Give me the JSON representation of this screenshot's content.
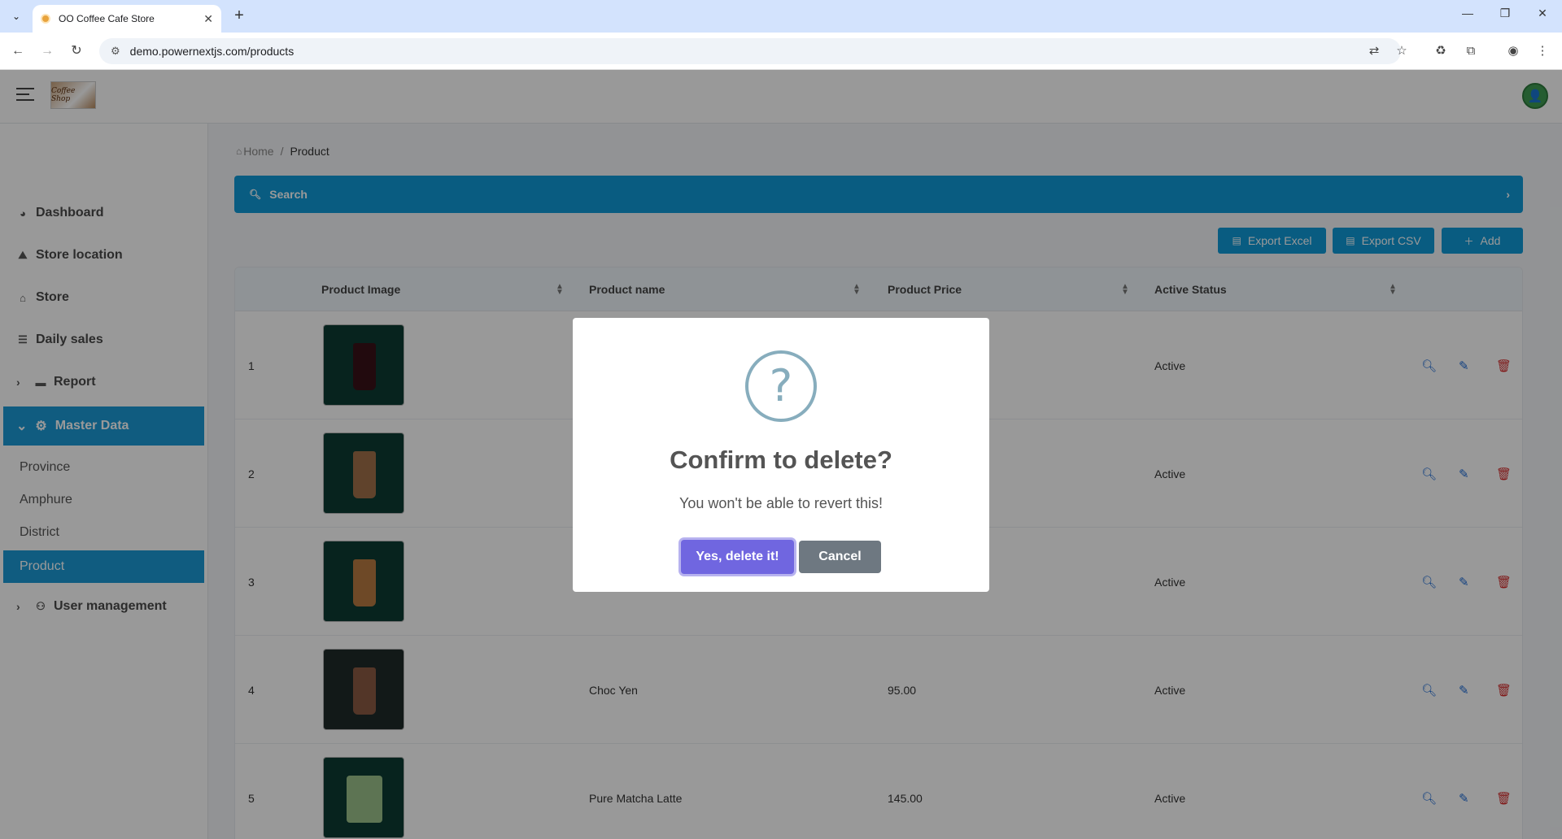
{
  "browser": {
    "tab_title": "OO Coffee Cafe Store",
    "url": "demo.powernextjs.com/products"
  },
  "header": {
    "logo_text": "Coffee Shop"
  },
  "sidebar": {
    "items": [
      {
        "label": "Dashboard",
        "icon": "dashboard-icon"
      },
      {
        "label": "Store location",
        "icon": "map-icon"
      },
      {
        "label": "Store",
        "icon": "store-icon"
      },
      {
        "label": "Daily sales",
        "icon": "list-icon"
      },
      {
        "label": "Report",
        "icon": "folder-icon"
      },
      {
        "label": "Master Data",
        "icon": "users-cog-icon"
      },
      {
        "label": "User management",
        "icon": "user-cog-icon"
      }
    ],
    "sub_items": [
      "Province",
      "Amphure",
      "District",
      "Product"
    ]
  },
  "breadcrumb": {
    "home": "Home",
    "current": "Product"
  },
  "search": {
    "label": "Search"
  },
  "toolbar": {
    "export_excel": "Export Excel",
    "export_csv": "Export CSV",
    "add": "Add"
  },
  "table": {
    "headers": [
      "Product Image",
      "Product name",
      "Product Price",
      "Active Status"
    ],
    "rows": [
      {
        "no": "1",
        "name": "",
        "price": "",
        "status": "Active",
        "cup_color": "#3a1218"
      },
      {
        "no": "2",
        "name": "",
        "price": "",
        "status": "Active",
        "cup_color": "#a0704a"
      },
      {
        "no": "3",
        "name": "",
        "price": "",
        "status": "Active",
        "cup_color": "#b87a42"
      },
      {
        "no": "4",
        "name": "Choc Yen",
        "price": "95.00",
        "status": "Active",
        "cup_color": "#8a5a44"
      },
      {
        "no": "5",
        "name": "Pure Matcha Latte",
        "price": "145.00",
        "status": "Active",
        "cup_color": "#9cc28a"
      }
    ]
  },
  "modal": {
    "title": "Confirm to delete?",
    "text": "You won't be able to revert this!",
    "confirm": "Yes, delete it!",
    "cancel": "Cancel"
  }
}
